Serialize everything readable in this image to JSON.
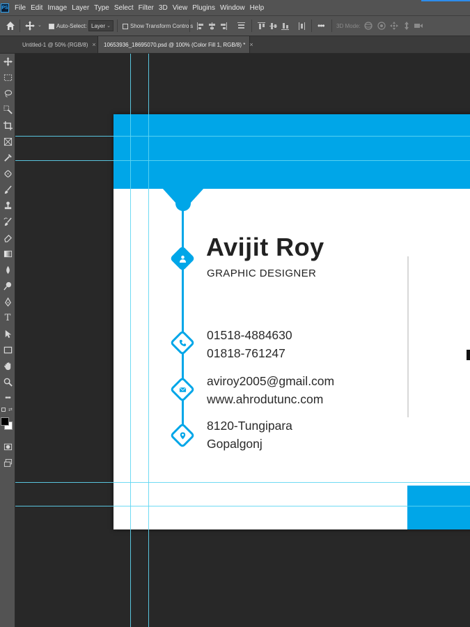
{
  "menu": {
    "app_icon": "PS",
    "items": [
      "File",
      "Edit",
      "Image",
      "Layer",
      "Type",
      "Select",
      "Filter",
      "3D",
      "View",
      "Plugins",
      "Window",
      "Help"
    ]
  },
  "options": {
    "auto_select_label": "Auto-Select:",
    "auto_select_checked": true,
    "auto_select_target": "Layer",
    "show_transform_label": "Show Transform Controls",
    "show_transform_checked": false,
    "mode_3d_label": "3D Mode:"
  },
  "tabs": [
    {
      "label": "Untitled-1 @ 50% (RGB/8)",
      "close": "×"
    },
    {
      "label": "10653936_18695070.psd @ 100% (Color Fill 1, RGB/8) *",
      "close": "×"
    }
  ],
  "tools": [
    "move-icon",
    "marquee-icon",
    "lasso-icon",
    "quick-select-icon",
    "crop-icon",
    "frame-icon",
    "eyedropper-icon",
    "healing-icon",
    "brush-icon",
    "stamp-icon",
    "history-brush-icon",
    "eraser-icon",
    "gradient-icon",
    "blur-icon",
    "dodge-icon",
    "pen-icon",
    "type-icon",
    "path-select-icon",
    "rectangle-icon",
    "hand-icon",
    "zoom-icon",
    "more-tools-icon"
  ],
  "colors": {
    "accent": "#00a6e8",
    "foreground": "#000000",
    "background": "#ffffff"
  },
  "card": {
    "name": "Avijit Roy",
    "title": "GRAPHIC DESIGNER",
    "phone1": "01518-4884630",
    "phone2": "01818-761247",
    "email": "aviroy2005@gmail.com",
    "website": "www.ahrodutunc.com",
    "address1": "8120-Tungipara",
    "address2": "Gopalgonj"
  }
}
